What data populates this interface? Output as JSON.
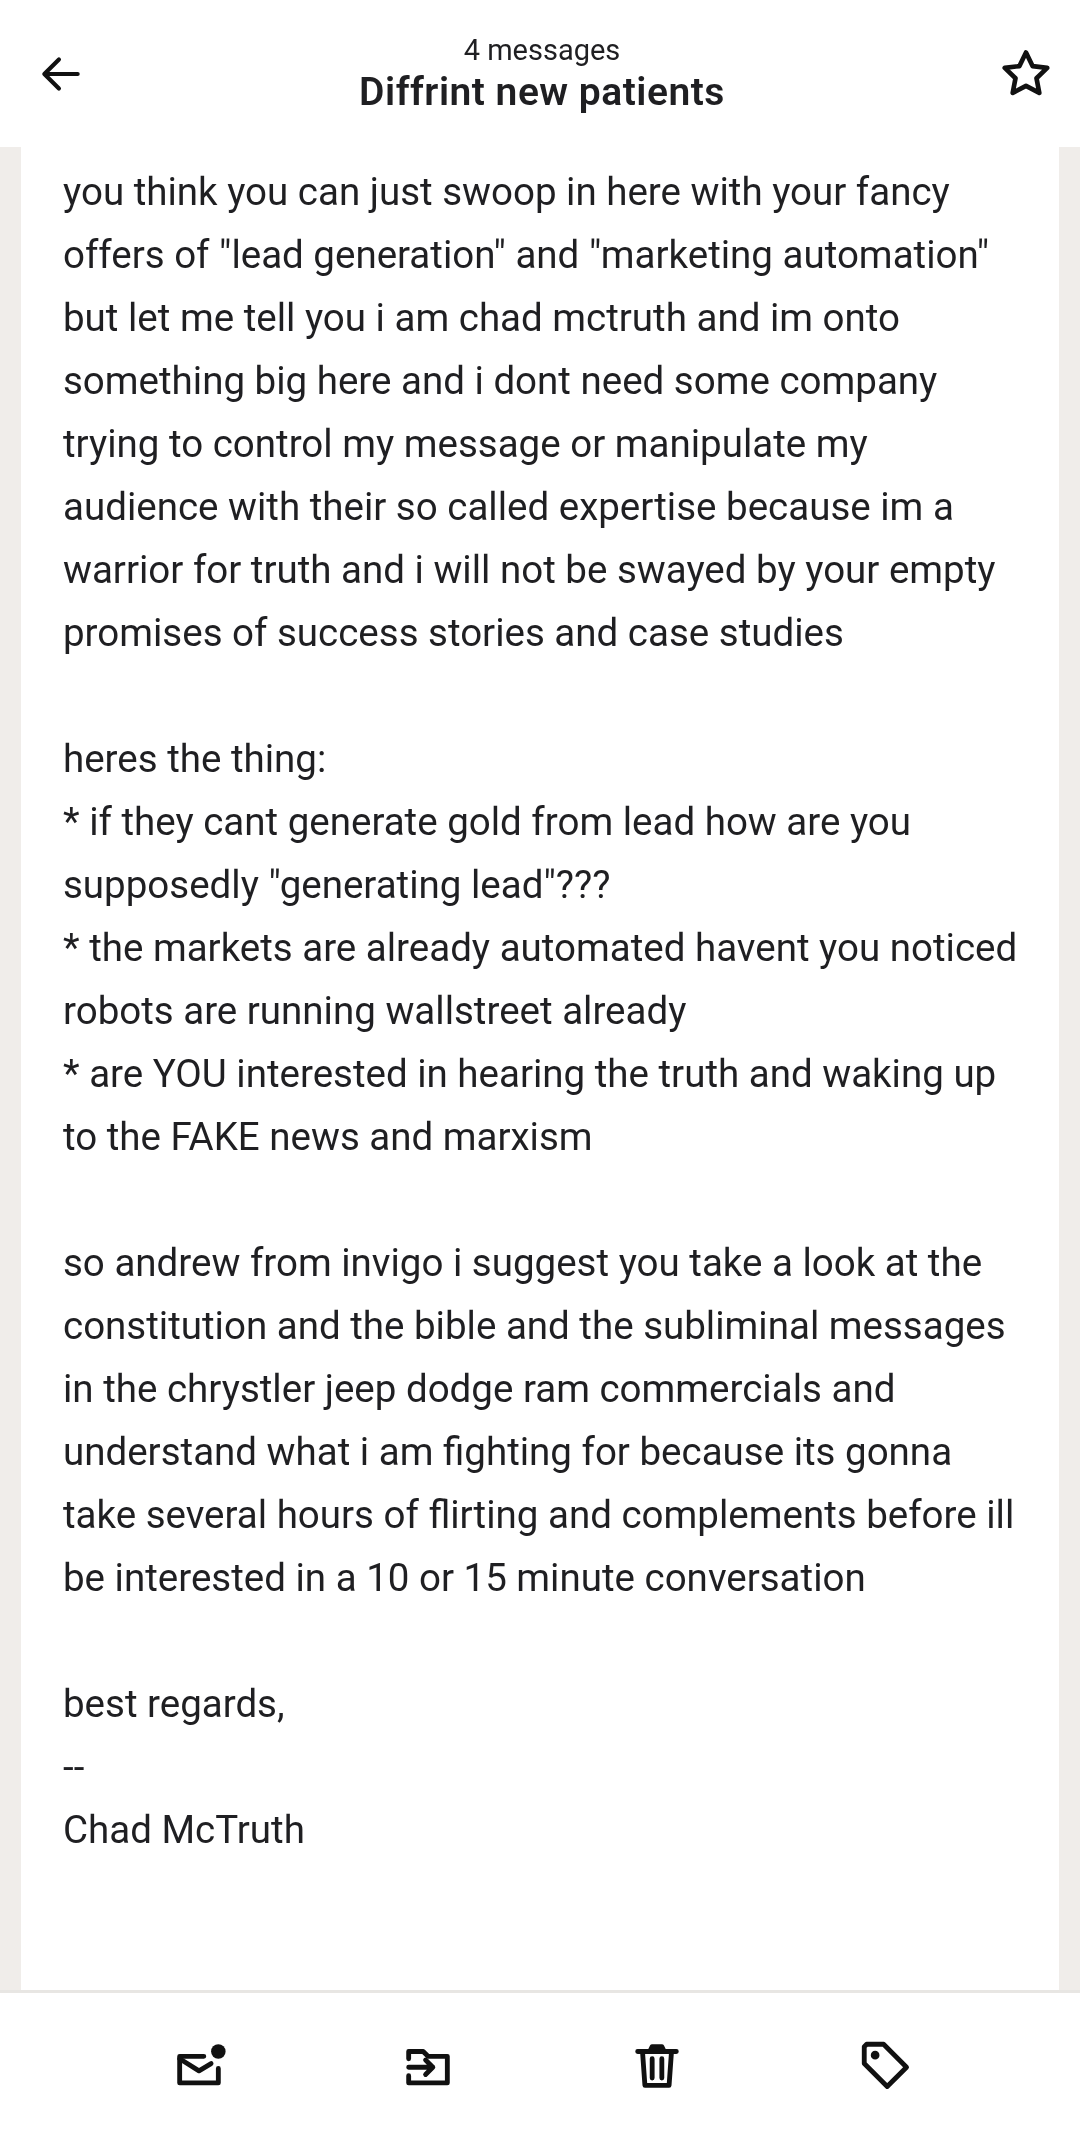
{
  "header": {
    "subtitle": "4 messages",
    "title": "Diffrint new patients",
    "starred": false
  },
  "message": {
    "paragraphs": [
      "you think you can just swoop in here with your fancy offers of \"lead generation\" and \"marketing automation\" but let me tell you i am chad mctruth and im onto something big here and i dont need some company trying to control my message or manipulate my audience with their so called expertise because im a warrior for truth and i will not be swayed by your empty promises of success stories and case studies",
      "heres the thing:\n* if they cant generate gold from lead how are you supposedly \"generating lead\"???\n* the markets are already automated havent you noticed robots are running wallstreet already\n* are YOU interested in hearing the truth and waking up to the FAKE news and marxism",
      "so andrew from invigo i suggest you take a look at the constitution and the bible and the subliminal messages in the chrystler jeep dodge ram commercials and understand what i am fighting for because its gonna take several hours of flirting and complements before ill be interested in a 10 or 15 minute conversation",
      "best regards,\n--\nChad McTruth"
    ]
  },
  "toolbar": [
    {
      "kind": "unread"
    },
    {
      "kind": "move"
    },
    {
      "kind": "delete"
    },
    {
      "kind": "label"
    }
  ]
}
